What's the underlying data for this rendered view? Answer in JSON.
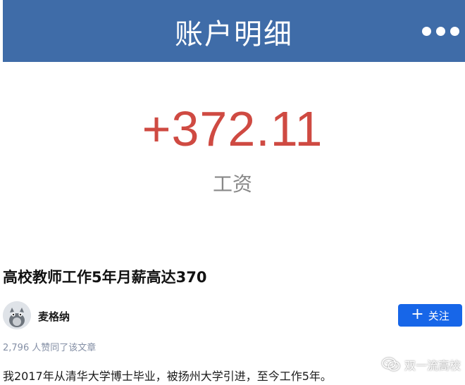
{
  "header": {
    "title": "账户明细",
    "more_icon": "more-dots-icon",
    "background_color": "#3f6ca8"
  },
  "transaction": {
    "amount": "+372.11",
    "label": "工资",
    "amount_color": "#cf4a42"
  },
  "article": {
    "title": "高校教师工作5年月薪高达370",
    "author": {
      "name": "麦格纳",
      "avatar_icon": "avatar-icon"
    },
    "follow_button": {
      "label": "关注",
      "icon": "plus-icon",
      "color": "#1766e8"
    },
    "likes": {
      "count": "2,796",
      "text": "人赞同了该文章"
    },
    "body_first_line": "我2017年从清华大学博士毕业，被扬州大学引进，至今工作5年。"
  },
  "watermark": {
    "icon": "wechat-icon",
    "text": "双一流高校"
  }
}
